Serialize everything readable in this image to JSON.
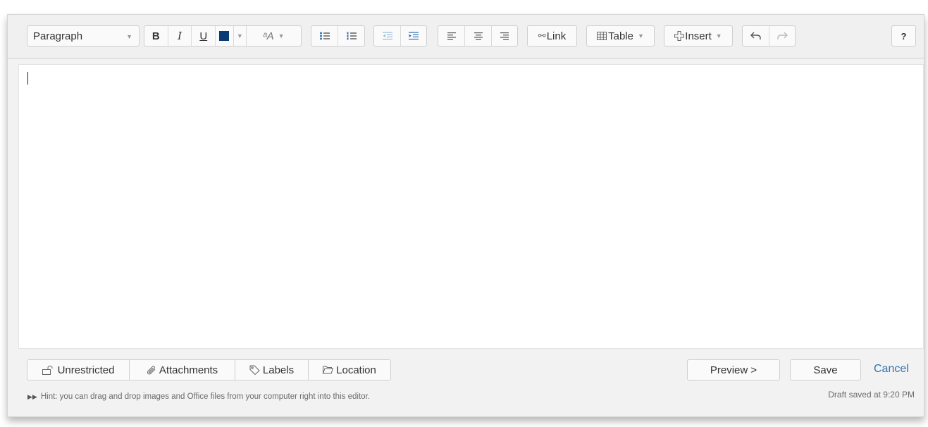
{
  "toolbar": {
    "paragraph_select": {
      "value": "Paragraph"
    },
    "bold_label": "B",
    "italic_label": "I",
    "underline_label": "U",
    "text_color": "#0a3a73",
    "font_size_label": "ᵃA",
    "link_label": "Link",
    "table_label": "Table",
    "insert_label": "Insert",
    "help_label": "?"
  },
  "editor": {
    "content": ""
  },
  "footer": {
    "buttons": {
      "restrictions": "Unrestricted",
      "attachments": "Attachments",
      "labels": "Labels",
      "location": "Location"
    },
    "preview_label": "Preview >",
    "save_label": "Save",
    "cancel_label": "Cancel",
    "hint_text": "Hint: you can drag and drop images and Office files from your computer right into this editor.",
    "draft_status": "Draft saved at 9:20 PM"
  },
  "colors": {
    "accent": "#3572b0",
    "toolbar_bg": "#f0f0f0",
    "text_color_swatch": "#0a3a73"
  }
}
